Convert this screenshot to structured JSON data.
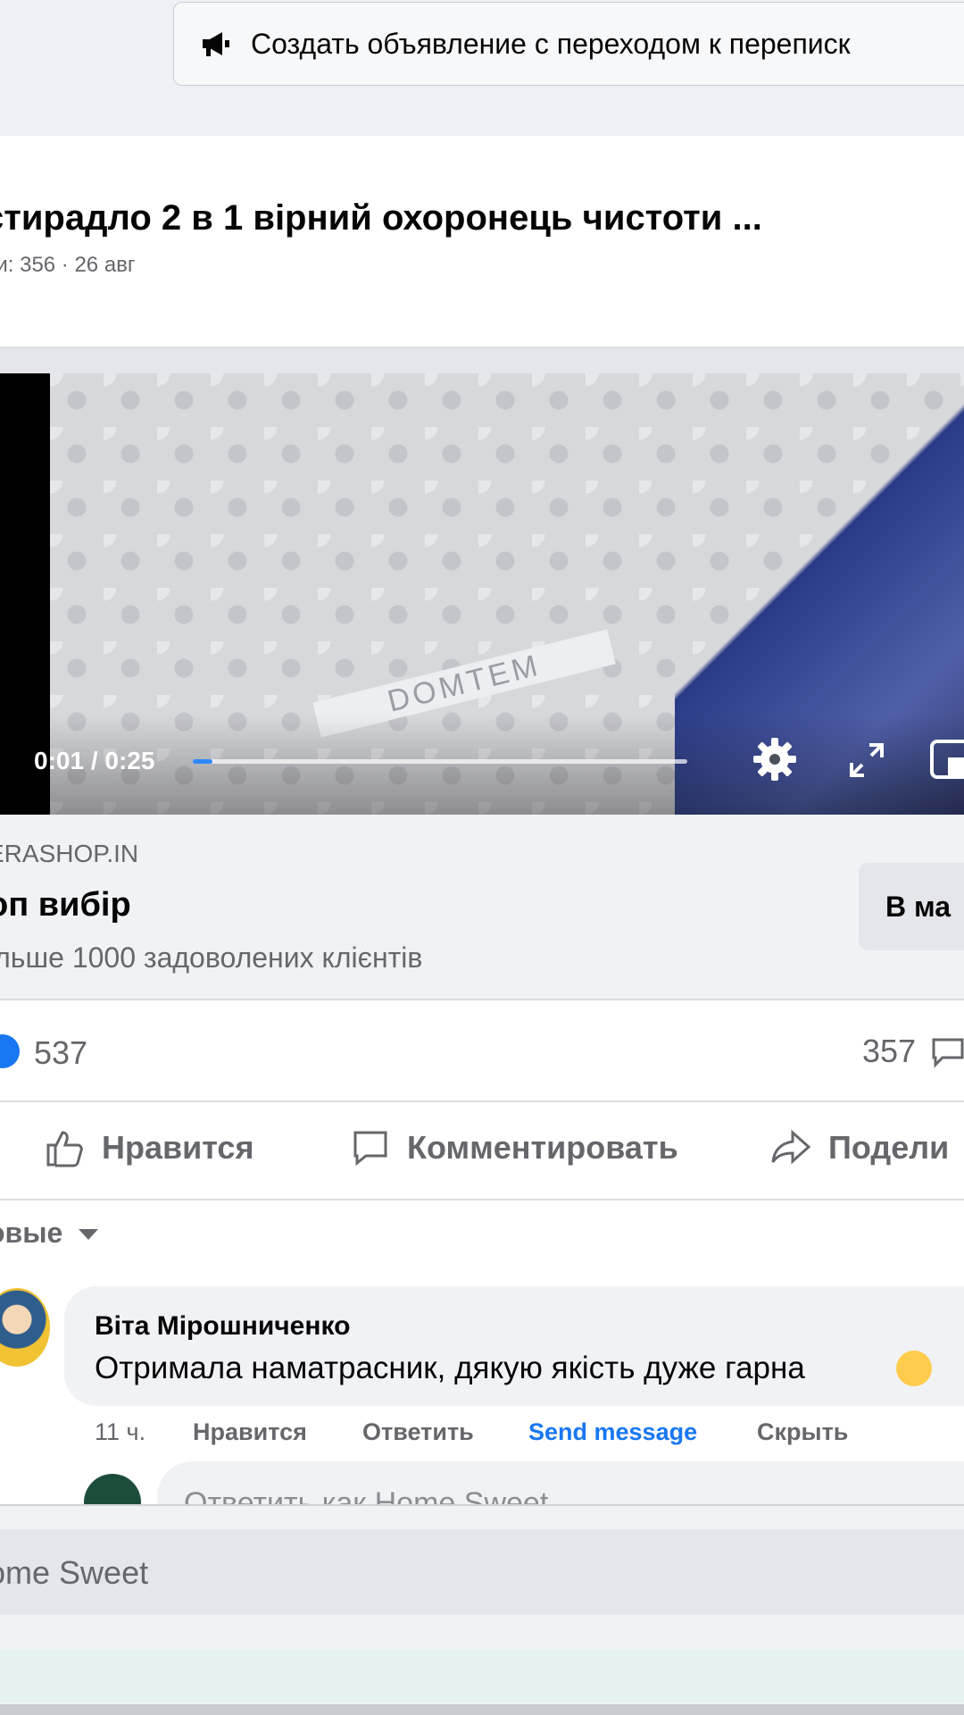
{
  "ad_button": {
    "label": "Создать объявление с переходом к переписк",
    "icon": "megaphone-icon"
  },
  "post": {
    "title": "стирадло 2 в 1 вірний охоронець чистоти ...",
    "meta": "ои: 356 · 26 авг"
  },
  "video": {
    "time": "0:01 / 0:25",
    "progress": 0.04,
    "tag_text": "DOMTEM"
  },
  "link_preview": {
    "domain": "ERASHOP.IN",
    "title": "оп вибір",
    "description": "ільше 1000 задоволених клієнтів",
    "button_label": "В ма"
  },
  "stats": {
    "likes": "537",
    "comments": "357"
  },
  "actions": {
    "like": "Нравится",
    "comment": "Комментировать",
    "share": "Подели"
  },
  "comments": {
    "sort_label": "овые",
    "items": [
      {
        "author": "Віта Мірошниченко",
        "text": "Отримала наматрасник, дякую якість дуже гарна",
        "time": "11 ч.",
        "like": "Нравится",
        "reply": "Ответить",
        "send": "Send message",
        "hide": "Скрыть"
      }
    ],
    "reply_placeholder": "Ответить как Home Sweet"
  },
  "composer": {
    "placeholder": "ome Sweet"
  },
  "colors": {
    "accent": "#1877f2",
    "link_blue": "#2d88ff"
  }
}
